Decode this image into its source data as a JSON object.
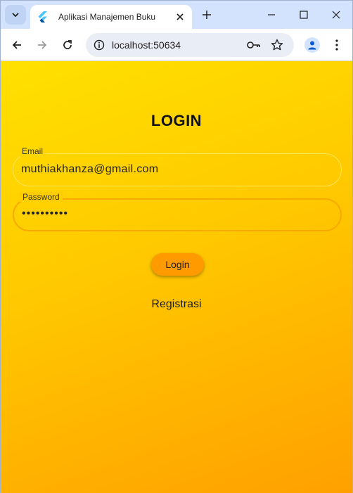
{
  "browser": {
    "tab_title": "Aplikasi Manajemen Buku",
    "url": "localhost:50634"
  },
  "page": {
    "title": "LOGIN",
    "email": {
      "label": "Email",
      "value": "muthiakhanza@gmail.com"
    },
    "password": {
      "label": "Password",
      "value": "••••••••••"
    },
    "login_button": "Login",
    "register_link": "Registrasi"
  },
  "colors": {
    "gradient_start": "#ffe100",
    "gradient_end": "#ffa000",
    "button": "#ff9a00"
  }
}
